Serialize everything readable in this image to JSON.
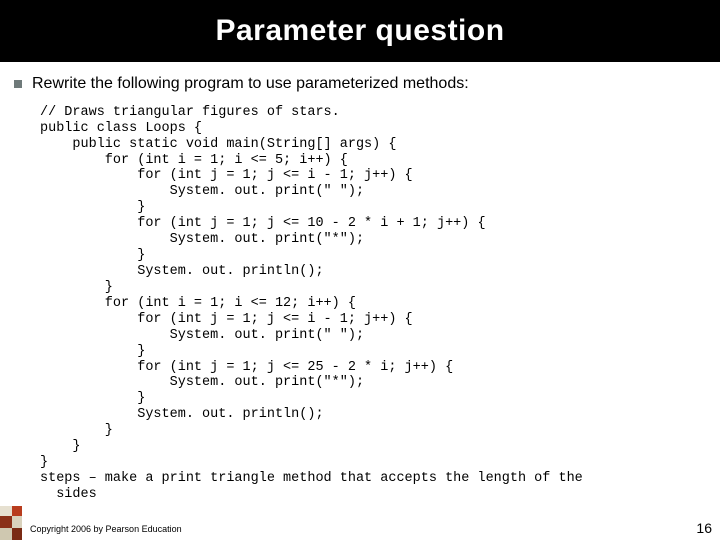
{
  "slide": {
    "title": "Parameter question",
    "bullet": "Rewrite the following program to use parameterized methods:",
    "code": "// Draws triangular figures of stars.\npublic class Loops {\n    public static void main(String[] args) {\n        for (int i = 1; i <= 5; i++) {\n            for (int j = 1; j <= i - 1; j++) {\n                System. out. print(\" \");\n            }\n            for (int j = 1; j <= 10 - 2 * i + 1; j++) {\n                System. out. print(\"*\");\n            }\n            System. out. println();\n        }\n        for (int i = 1; i <= 12; i++) {\n            for (int j = 1; j <= i - 1; j++) {\n                System. out. print(\" \");\n            }\n            for (int j = 1; j <= 25 - 2 * i; j++) {\n                System. out. print(\"*\");\n            }\n            System. out. println();\n        }\n    }\n}",
    "steps_note": "steps – make a print triangle method that accepts the length of the\n  sides",
    "footer": "Copyright 2006 by Pearson Education",
    "page_number": "16"
  }
}
